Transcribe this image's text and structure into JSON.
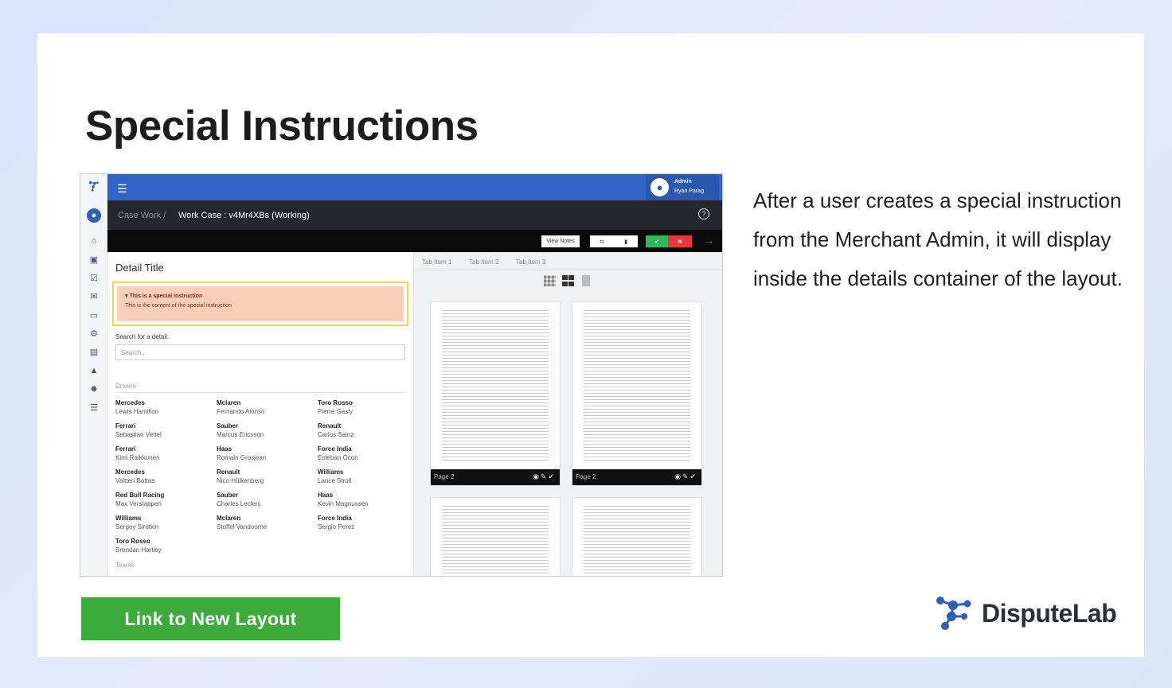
{
  "slide": {
    "title": "Special Instructions",
    "description": "After a user creates a special instruction from the Merchant Admin, it will display inside the details container of the layout.",
    "cta_label": "Link to New Layout",
    "brand_name": "DisputeLab"
  },
  "app": {
    "user_role": "Admin",
    "user_name": "Ryan Parag",
    "breadcrumb_root": "Case Work /",
    "breadcrumb_current": "Work Case : v4Mr4XBs (Working)",
    "toolbar": {
      "view_notes_label": "View Notes"
    },
    "detail": {
      "title": "Detail Title",
      "special_heading": "▾ This is a special instruction",
      "special_content": "This is the content of the special instruction",
      "search_label": "Search for a detail:",
      "search_placeholder": "Search...",
      "drivers_label": "Drivers",
      "teams_label": "Teams",
      "drivers": [
        [
          {
            "team": "Mercedes",
            "name": "Lewis Hamilton"
          },
          {
            "team": "Ferrari",
            "name": "Sebastian Vettel"
          },
          {
            "team": "Ferrari",
            "name": "Kimi Raikkonen"
          },
          {
            "team": "Mercedes",
            "name": "Valtteri Bottas"
          },
          {
            "team": "Red Bull Racing",
            "name": "Max Verstappen"
          },
          {
            "team": "Williams",
            "name": "Sergey Sirotkin"
          },
          {
            "team": "Toro Rosso",
            "name": "Brendan Hartley"
          }
        ],
        [
          {
            "team": "Mclaren",
            "name": "Fernando Alonso"
          },
          {
            "team": "Sauber",
            "name": "Marcus Ericsson"
          },
          {
            "team": "Haas",
            "name": "Romain Grosjean"
          },
          {
            "team": "Renault",
            "name": "Nico Hülkenberg"
          },
          {
            "team": "Sauber",
            "name": "Charles Leclerc"
          },
          {
            "team": "Mclaren",
            "name": "Stoffel Vandoorne"
          }
        ],
        [
          {
            "team": "Toro Rosso",
            "name": "Pierre Gasly"
          },
          {
            "team": "Renault",
            "name": "Carlos Sainz"
          },
          {
            "team": "Force India",
            "name": "Esteban Ocon"
          },
          {
            "team": "Williams",
            "name": "Lance Stroll"
          },
          {
            "team": "Haas",
            "name": "Kevin Magnussen"
          },
          {
            "team": "Force India",
            "name": "Sergio Perez"
          }
        ]
      ]
    },
    "tabs": [
      "Tab Item 1",
      "Tab Item 2",
      "Tab Item 3"
    ],
    "pages": [
      {
        "label": "Page 2"
      },
      {
        "label": "Page 2"
      }
    ]
  },
  "colors": {
    "topbar": "#3264c8",
    "cta": "#3cab3c",
    "special_bg": "#f8cfb9",
    "special_border": "#f4d24a"
  }
}
